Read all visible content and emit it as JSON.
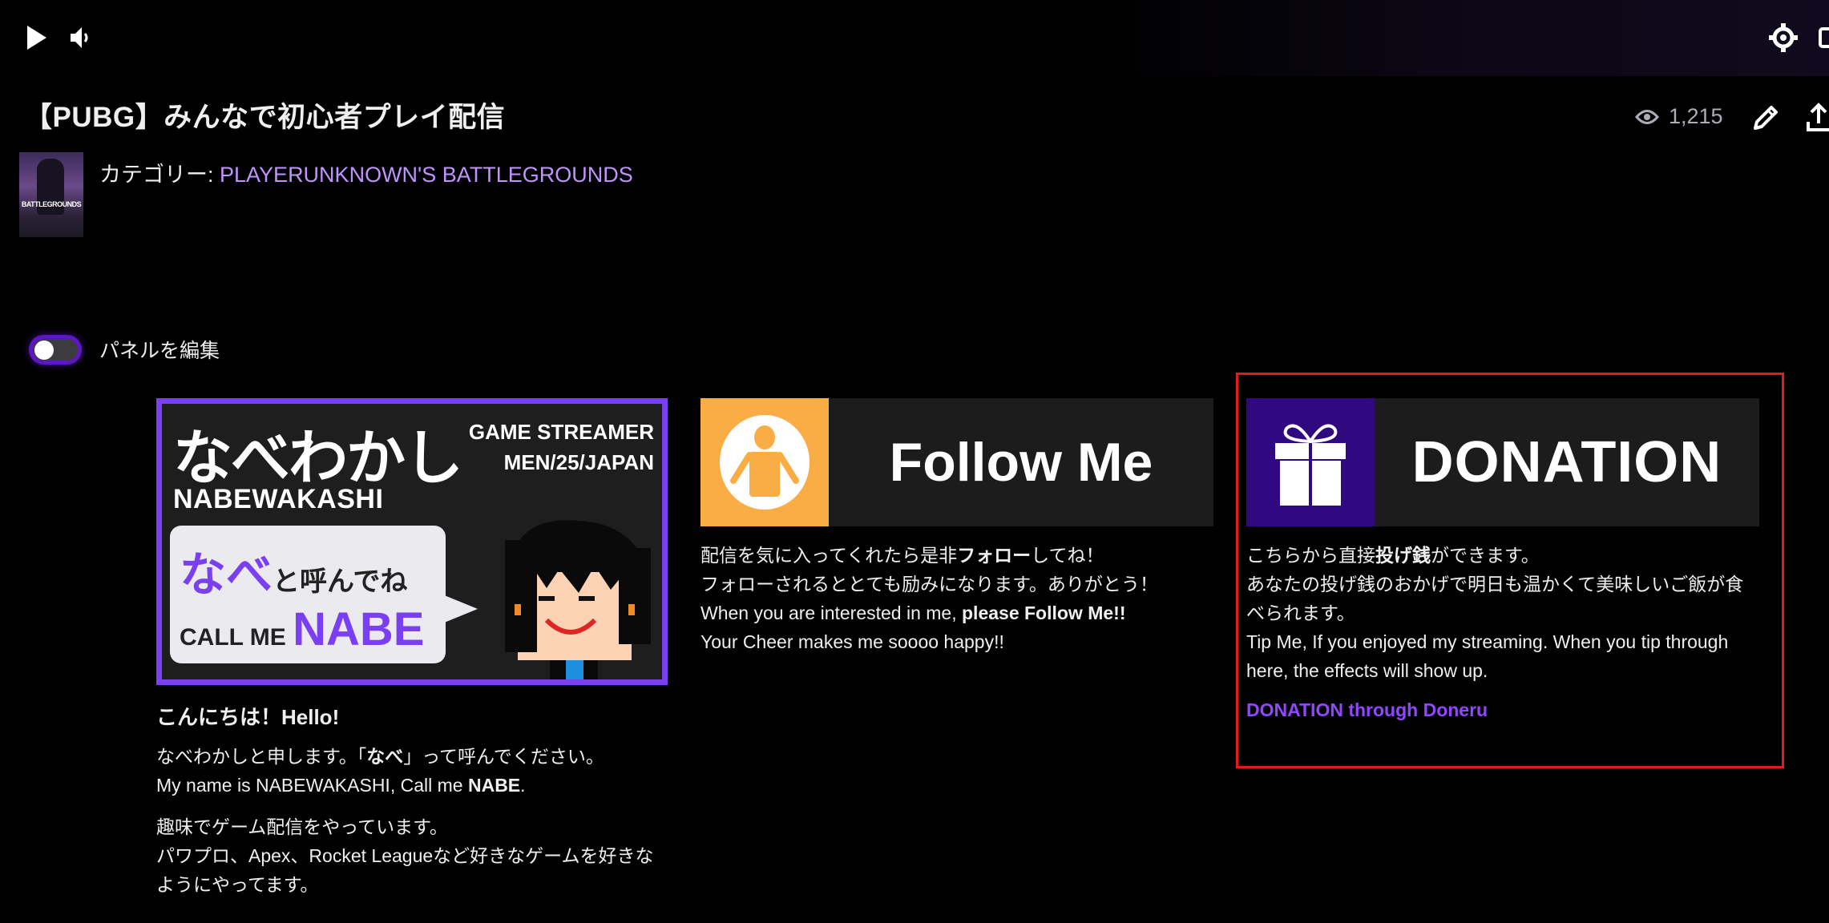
{
  "player": {
    "play_icon": "play-icon",
    "volume_icon": "volume-icon",
    "settings_icon": "gear-icon",
    "theater_icon": "theater-mode-icon"
  },
  "stream": {
    "title": "【PUBG】みんなで初心者プレイ配信",
    "category_label": "カテゴリー: ",
    "category_name": "PLAYERUNKNOWN'S BATTLEGROUNDS",
    "thumbnail_text": "BATTLEGROUNDS",
    "viewer_count": "1,215"
  },
  "edit_panels": {
    "label": "パネルを編集",
    "enabled": false
  },
  "colors": {
    "accent": "#9147ff",
    "link": "#bf94ff",
    "highlight_border": "#e31b1b",
    "follow_orange": "#fbad45",
    "donation_purple": "#300980"
  },
  "panels": [
    {
      "banner": {
        "name_jp": "なべわかし",
        "name_en": "NABEWAKASHI",
        "role_line1": "GAME STREAMER",
        "role_line2": "MEN/25/JAPAN",
        "bubble_nabe_jp": "なべ",
        "bubble_call_jp": "と呼んでね",
        "bubble_call_en": "CALL ME ",
        "bubble_nabe_en": "NABE"
      },
      "heading": "こんにちは！Hello!",
      "para1_l1_a": "なべわかしと申します。「",
      "para1_l1_b": "なべ",
      "para1_l1_c": "」って呼んでください。",
      "para1_l2_a": "My name is NABEWAKASHI, Call me ",
      "para1_l2_b": "NABE",
      "para1_l2_c": ".",
      "para2_l1": "趣味でゲーム配信をやっています。",
      "para2_l2": "パワプロ、Apex、Rocket Leagueなど好きなゲームを好きなようにやってます。"
    },
    {
      "banner": {
        "text": "Follow Me",
        "icon": "person-icon"
      },
      "l1_a": "配信を気に入ってくれたら是非",
      "l1_b": "フォロー",
      "l1_c": "してね！",
      "l2": "フォローされるととても励みになります。ありがとう！",
      "l3_a": "When you are interested in me, ",
      "l3_b": "please Follow Me!!",
      "l4": "Your Cheer makes me soooo happy!!"
    },
    {
      "banner": {
        "text": "DONATION",
        "icon": "gift-icon"
      },
      "l1_a": "こちらから直接",
      "l1_b": "投げ銭",
      "l1_c": "ができます。",
      "l2": "あなたの投げ銭のおかげで明日も温かくて美味しいご飯が食べられます。",
      "l3": "Tip Me, If you enjoyed my streaming. When you tip through here, the effects will show up.",
      "link": "DONATION through Doneru"
    }
  ]
}
